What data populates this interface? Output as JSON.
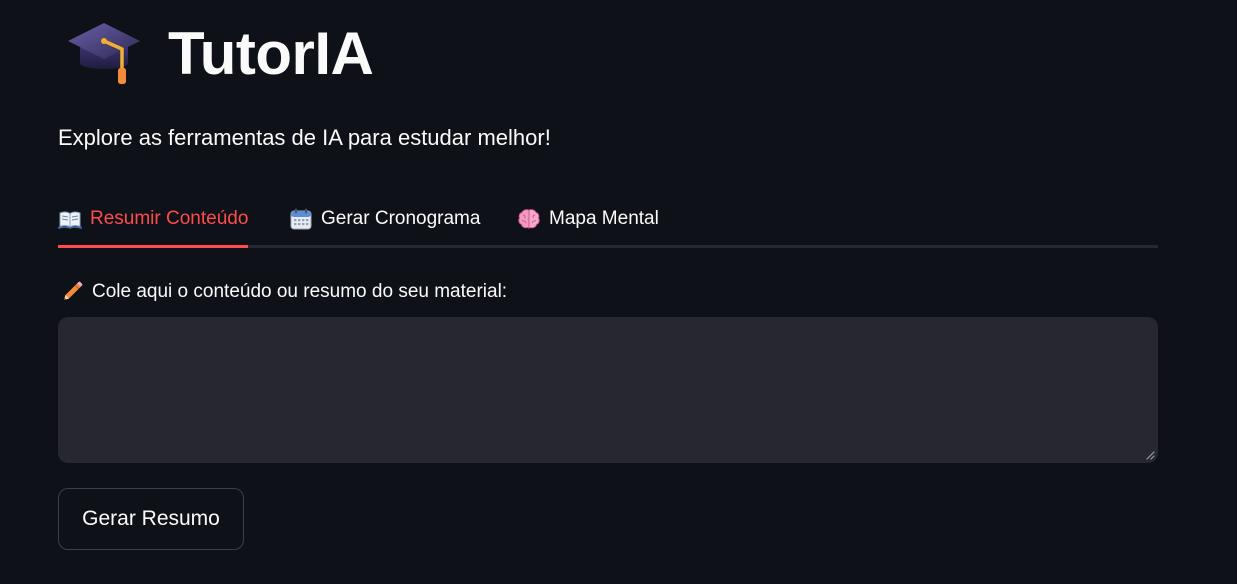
{
  "app": {
    "title": "TutorIA",
    "title_icon": "graduation-cap-icon",
    "subtitle": "Explore as ferramentas de IA para estudar melhor!"
  },
  "tabs": [
    {
      "label": "Resumir Conteúdo",
      "icon": "open-book-icon",
      "active": true
    },
    {
      "label": "Gerar Cronograma",
      "icon": "calendar-icon",
      "active": false
    },
    {
      "label": "Mapa Mental",
      "icon": "brain-icon",
      "active": false
    }
  ],
  "form": {
    "label": "Cole aqui o conteúdo ou resumo do seu material:",
    "label_icon": "pencil-icon",
    "textarea_value": "",
    "submit_label": "Gerar Resumo"
  },
  "colors": {
    "background": "#0e1117",
    "accent": "#ff4b4b",
    "input_background": "#262730",
    "text": "#fafafa"
  }
}
